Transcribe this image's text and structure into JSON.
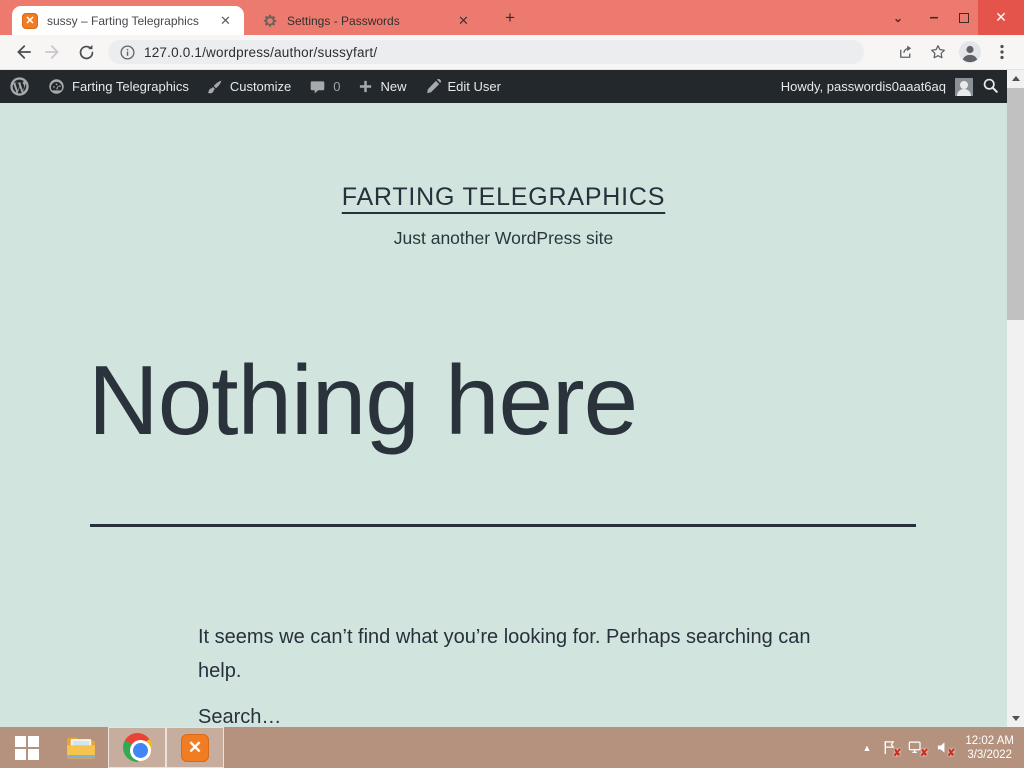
{
  "browser": {
    "tabs": [
      {
        "title": "sussy – Farting Telegraphics"
      },
      {
        "title": "Settings - Passwords"
      }
    ],
    "url": "127.0.0.1/wordpress/author/sussyfart/"
  },
  "admin_bar": {
    "site_name": "Farting Telegraphics",
    "customize": "Customize",
    "comments_count": "0",
    "new_item": "New",
    "edit_user": "Edit User",
    "howdy": "Howdy, passwordis0aaat6aq"
  },
  "page": {
    "site_title": "FARTING TELEGRAPHICS",
    "tagline": "Just another WordPress site",
    "heading": "Nothing here",
    "not_found_message": "It seems we can’t find what you’re looking for. Perhaps searching can help.",
    "search_label": "Search…"
  },
  "taskbar": {
    "time": "12:02 AM",
    "date": "3/3/2022"
  },
  "colors": {
    "browser_frame": "#ed7a6e",
    "close_button": "#e4544a",
    "page_background": "#d1e4dd",
    "admin_bar_background": "#23282d",
    "text_primary": "#28303d",
    "taskbar_background": "#b5927d"
  }
}
